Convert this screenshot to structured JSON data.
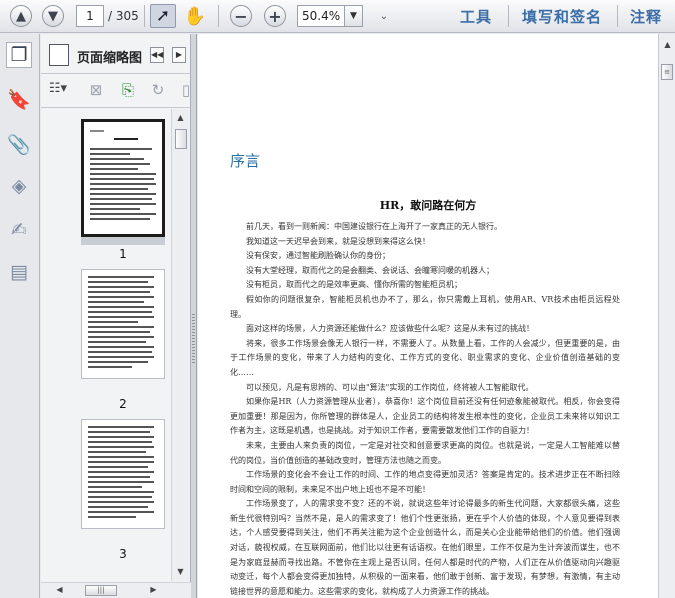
{
  "toolbar": {
    "page_current": "1",
    "page_total": "/ 305",
    "zoom": "50.4%",
    "tools_label": "工具",
    "sign_label": "填写和签名",
    "comment_label": "注释"
  },
  "thumbnail_panel": {
    "title": "页面缩略图",
    "pages": [
      {
        "label": "1"
      },
      {
        "label": "2"
      },
      {
        "label": "3"
      }
    ]
  },
  "document": {
    "section_title": "序言",
    "title": "HR，敢问路在何方",
    "paragraphs": [
      "前几天，看到一则新闻：中国建设银行在上海开了一家真正的无人银行。",
      "我知道这一天迟早会到来，就是没想到来得这么快！",
      "没有保安，通过智能刷脸确认你的身份；",
      "没有大堂经理，取而代之的是会翻类、会说话、会瞳寒问暖的机器人；",
      "没有柜员，取而代之的是效率更高、懂你所需的智能柜员机；",
      "假如你的问题很复杂，智能柜员机也办不了，那么，你只需戴上耳机，使用AR、VR技术由柜员远程处理。",
      "面对这样的场景，人力资源还能做什么？应该做些什么呢？这是从未有过的挑战！",
      "将来，很多工作场景会像无人银行一样，不需要人了。从数量上看，工作的人会减少，但更重要的是，由于工作场景的变化，带来了人力结构的变化、工作方式的变化、职业需求的变化、企业价值创造基础的变化……",
      "可以预见，凡是有思辨的、可以由\"算法\"实现的工作岗位，终将被人工智能取代。",
      "如果你是HR（人力资源管理从业者），恭喜你！这个岗位目前还没有任何迹象能被取代。相反，你会变得更加重要！那是因为，你所管理的群体是人，企业员工的结构将发生根本性的变化，企业员工未来将以知识工作者为主，这既是机遇，也是挑战。对于知识工作者，要需要散发他们工作的自驱力！",
      "未来，主要由人来负责的岗位，一定是对社交和创意要求更高的岗位。也就是说，一定是人工智能难以替代的岗位，当价值创造的基础改变时，管理方法也随之而变。",
      "工作场景的变化会不会让工作的时间、工作的地点变得更加灵活？答案是肯定的。技术进步正在不断扫除时间和空间的限制，未来足不出户地上班也不是不可能！",
      "工作场景变了，人的需求变不变？还的不说，就说这些年讨论得最多的新生代问题，大家都很头痛，这些新生代很特别吗？当然不是，是人的需求变了！他们个性更张扬，更在乎个人价值的体现，个人意见要得到表达，个人感受要得到关注，他们不再关注能为这个企业创造什么，而是关心企业能带给他们的价值。他们强调对话，藐视权威，在互联网面前，他们比以往更有话语权。在他们眼里，工作不仅是为生计奔波而谋生，也不是为家庭显赫而寻找出路。不管你在主观上是否认同，任何人都是时代的产物，人们正在从价值驱动向兴趣驱动变迁，每个人都会变得更加独特，从积极的一面来看，他们敢于创新、富于发现，有梦想，有激情，有主动链接世界的意愿和能力。这些需求的变化，就构成了人力资源工作的挑战。"
    ]
  }
}
